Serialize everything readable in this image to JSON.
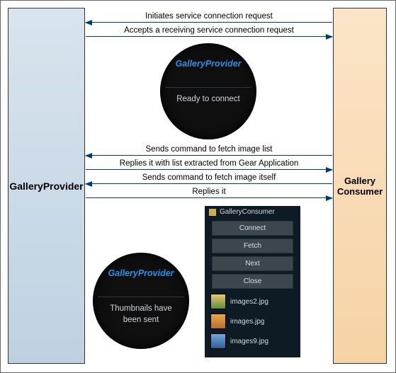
{
  "provider_label": "GalleryProvider",
  "consumer_label": "Gallery\nConsumer",
  "arrows": {
    "a0": "Initiates service connection request",
    "a1": "Accepts a receiving service connection request",
    "a2": "Sends command to fetch image list",
    "a3": "Replies it with list extracted from Gear Application",
    "a4": "Sends command to fetch image itself",
    "a5": "Replies it"
  },
  "watch1": {
    "title": "GalleryProvider",
    "message": "Ready to connect"
  },
  "watch2": {
    "title": "GalleryProvider",
    "message": "Thumbnails have\nbeen sent"
  },
  "phone": {
    "title": "GalleryConsumer",
    "buttons": [
      "Connect",
      "Fetch",
      "Next",
      "Close"
    ],
    "items": [
      "images2.jpg",
      "images.jpg",
      "images9.jpg"
    ]
  }
}
